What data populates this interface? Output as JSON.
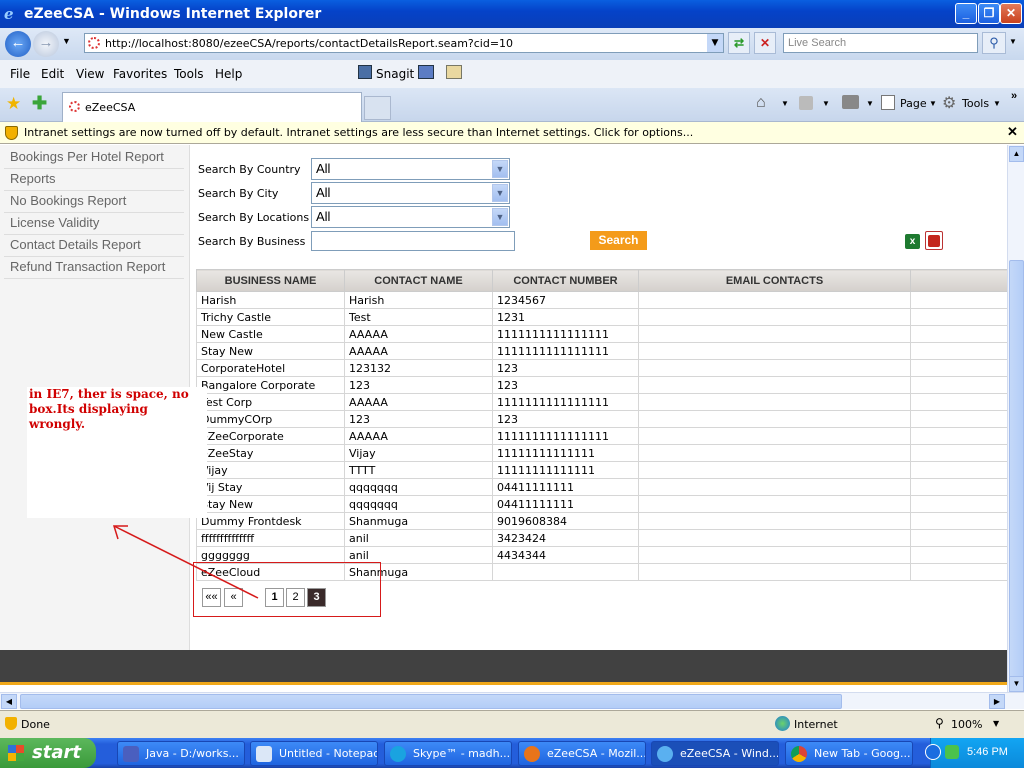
{
  "window": {
    "title": "eZeeCSA - Windows Internet Explorer",
    "minimize": "_",
    "restore": "❐",
    "close": "✕"
  },
  "navbar": {
    "address": "http://localhost:8080/ezeeCSA/reports/contactDetailsReport.seam?cid=10",
    "search_placeholder": "Live Search"
  },
  "menu": {
    "items": [
      "File",
      "Edit",
      "View",
      "Favorites",
      "Tools",
      "Help"
    ],
    "snagit": "Snagit"
  },
  "tabs": {
    "active": "eZeeCSA",
    "page_label": "Page",
    "tools_label": "Tools"
  },
  "infobar": {
    "text": "Intranet settings are now turned off by default. Intranet settings are less secure than Internet settings. Click for options...",
    "close": "✕"
  },
  "sidebar": {
    "items": [
      "Bookings Per Hotel Report",
      "Reports",
      "No Bookings Report",
      "License Validity",
      "Contact Details Report",
      "Refund Transaction Report"
    ]
  },
  "filters": {
    "country_label": "Search By Country",
    "country_value": "All",
    "city_label": "Search By City",
    "city_value": "All",
    "locations_label": "Search By Locations",
    "locations_value": "All",
    "business_label": "Search By Business",
    "business_value": "",
    "search_button": "Search"
  },
  "table": {
    "headers": [
      "BUSINESS NAME",
      "CONTACT NAME",
      "CONTACT NUMBER",
      "EMAIL CONTACTS"
    ],
    "rows": [
      [
        "Harish",
        "Harish",
        "1234567",
        ""
      ],
      [
        "Trichy Castle",
        "Test",
        "1231",
        ""
      ],
      [
        "New Castle",
        "AAAAA",
        "1111111111111111",
        ""
      ],
      [
        "Stay New",
        "AAAAA",
        "1111111111111111",
        ""
      ],
      [
        "CorporateHotel",
        "123132",
        "123",
        ""
      ],
      [
        "Bangalore Corporate",
        "123",
        "123",
        ""
      ],
      [
        "Test Corp",
        "AAAAA",
        "1111111111111111",
        ""
      ],
      [
        "DummyCOrp",
        "123",
        "123",
        ""
      ],
      [
        "eZeeCorporate",
        "AAAAA",
        "1111111111111111",
        ""
      ],
      [
        "eZeeStay",
        "Vijay",
        "11111111111111",
        ""
      ],
      [
        "Vijay",
        "TTTT",
        "11111111111111",
        ""
      ],
      [
        "Vij Stay",
        "qqqqqqq",
        "04411111111",
        ""
      ],
      [
        "Stay New",
        "qqqqqqq",
        "04411111111",
        ""
      ],
      [
        "Dummy Frontdesk",
        "Shanmuga",
        "9019608384",
        ""
      ],
      [
        "ffffffffffffff",
        "anil",
        "3423424",
        ""
      ],
      [
        "ggggggg",
        "anil",
        "4434344",
        ""
      ],
      [
        "eZeeCloud",
        "Shanmuga",
        "",
        ""
      ]
    ]
  },
  "pagination": {
    "first": "««",
    "prev": "«",
    "pages": [
      "1",
      "2",
      "3"
    ],
    "current": "3"
  },
  "annotation": {
    "text": "in IE7, ther is space, no box.Its displaying wrongly."
  },
  "status": {
    "left": "Done",
    "zone": "Internet",
    "zoom": "100%"
  },
  "taskbar": {
    "start": "start",
    "items": [
      "Java - D:/works...",
      "Untitled - Notepad",
      "Skype™ - madh...",
      "eZeeCSA - Mozil...",
      "eZeeCSA - Wind...",
      "New Tab - Goog..."
    ],
    "clock": "5:46 PM"
  }
}
